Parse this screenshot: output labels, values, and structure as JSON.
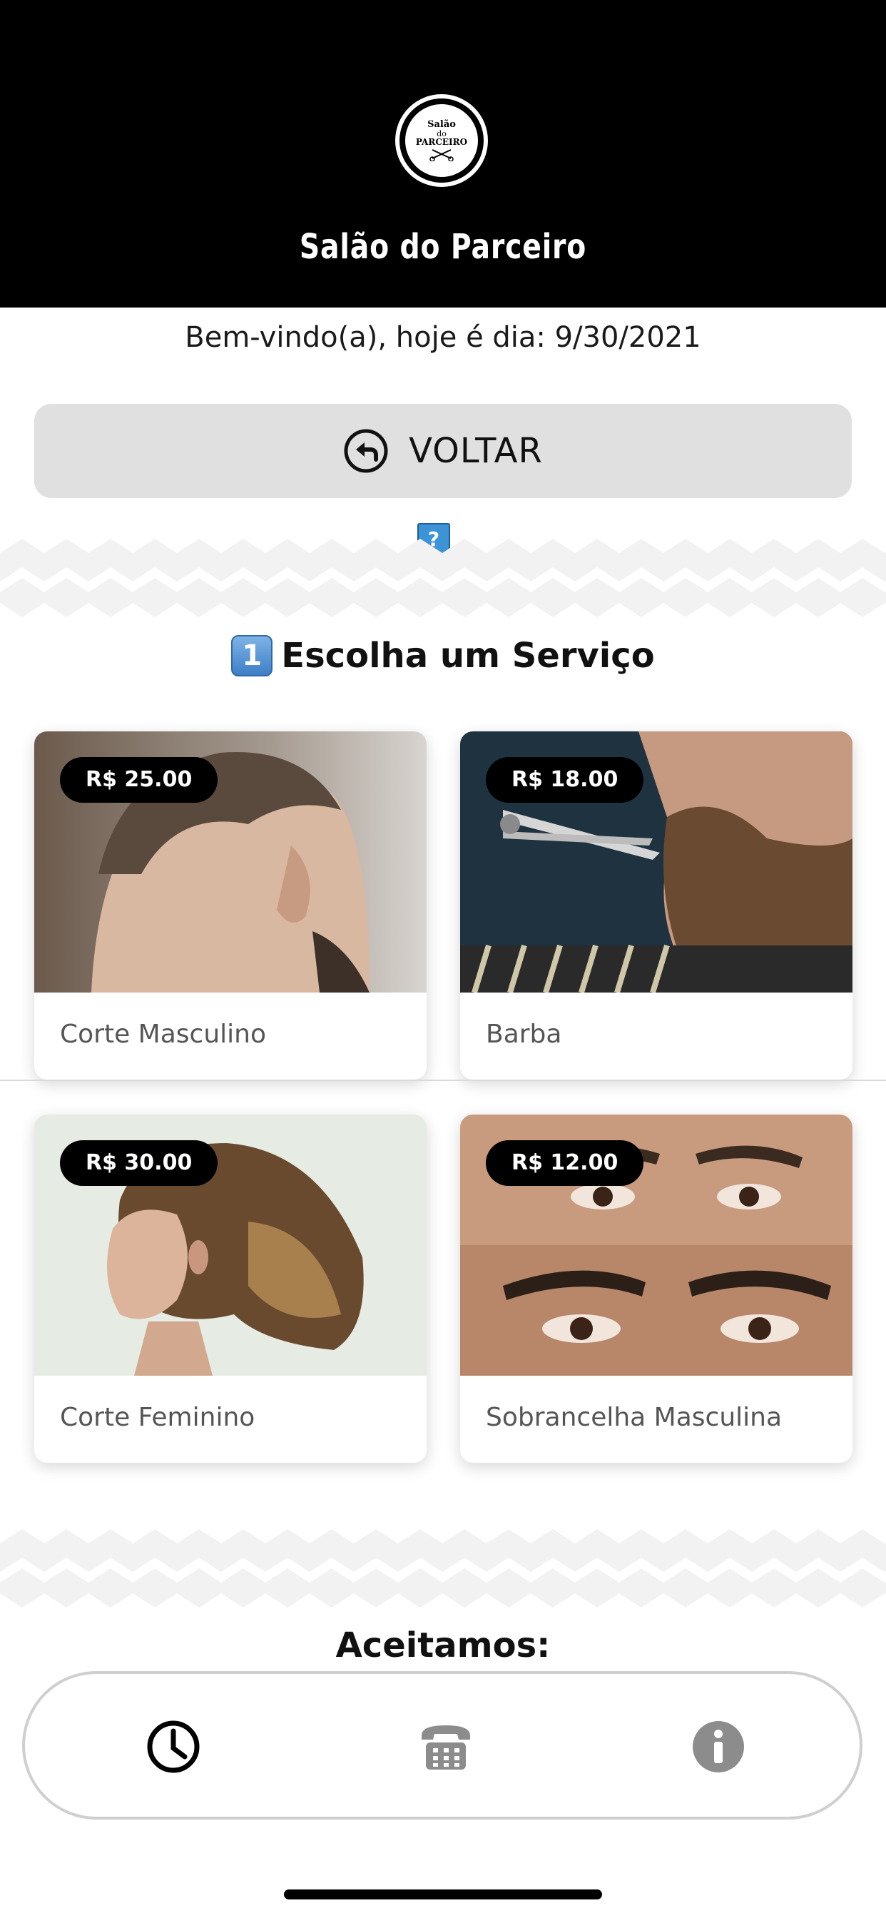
{
  "header": {
    "logo_text": [
      "Salão",
      "do",
      "PARCEIRO"
    ],
    "title": "Salão do Parceiro"
  },
  "welcome": {
    "text": "Bem-vindo(a), hoje é dia: 9/30/2021"
  },
  "back_button": {
    "label": "VOLTAR",
    "icon": "back-arrow-circle-icon"
  },
  "help_icon": "question-icon",
  "services_section": {
    "step_number": "1",
    "title": "Escolha um Serviço",
    "services": [
      {
        "name": "Corte Masculino",
        "price": "R$ 25.00",
        "image": "men-haircut-photo"
      },
      {
        "name": "Barba",
        "price": "R$ 18.00",
        "image": "beard-trim-photo"
      },
      {
        "name": "Corte Feminino",
        "price": "R$ 30.00",
        "image": "women-haircut-photo"
      },
      {
        "name": "Sobrancelha Masculina",
        "price": "R$ 12.00",
        "image": "eyebrows-photo"
      }
    ]
  },
  "accept": {
    "title": "Aceitamos:"
  },
  "bottom_nav": {
    "items": [
      {
        "icon": "clock-icon",
        "active": true
      },
      {
        "icon": "phone-icon",
        "active": false
      },
      {
        "icon": "info-icon",
        "active": false
      }
    ]
  },
  "colors": {
    "header_bg": "#000000",
    "button_bg": "#e0e0e0",
    "price_badge_bg": "#000000",
    "nav_active": "#000000",
    "nav_inactive": "#8c8c8c"
  }
}
